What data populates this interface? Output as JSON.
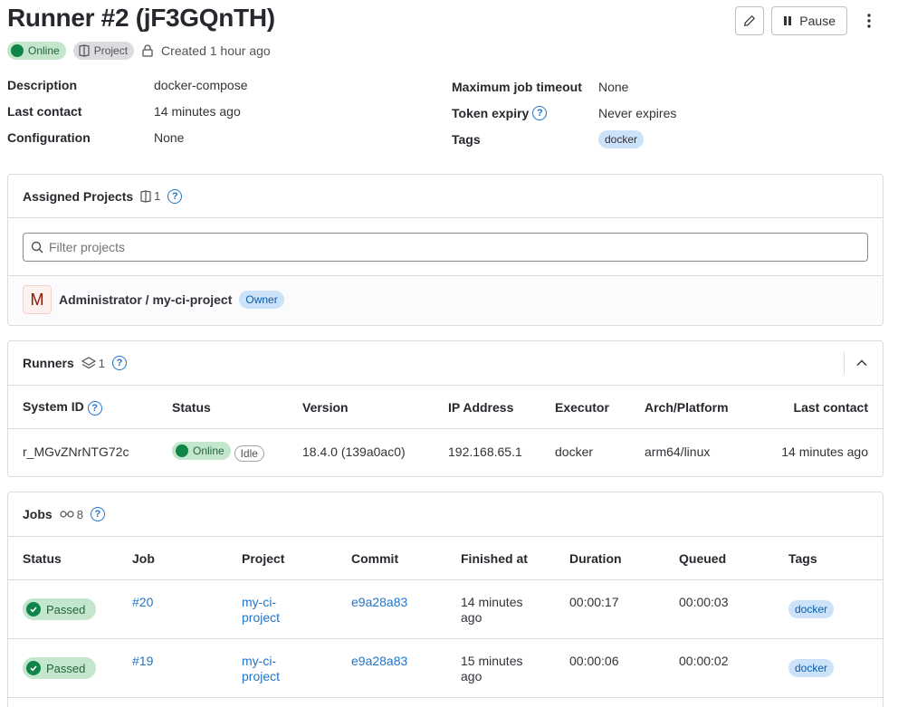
{
  "header": {
    "title": "Runner #2 (jF3GQnTH)",
    "status_badge": "Online",
    "type_badge": "Project",
    "created": "Created 1 hour ago",
    "pause_label": "Pause"
  },
  "details": {
    "description_label": "Description",
    "description_value": "docker-compose",
    "last_contact_label": "Last contact",
    "last_contact_value": "14 minutes ago",
    "configuration_label": "Configuration",
    "configuration_value": "None",
    "max_timeout_label": "Maximum job timeout",
    "max_timeout_value": "None",
    "token_expiry_label": "Token expiry",
    "token_expiry_value": "Never expires",
    "tags_label": "Tags",
    "tag": "docker"
  },
  "assigned_projects": {
    "title": "Assigned Projects",
    "count": "1",
    "filter_placeholder": "Filter projects",
    "avatar_letter": "M",
    "project_name": "Administrator / my-ci-project",
    "role_badge": "Owner"
  },
  "runners": {
    "title": "Runners",
    "count": "1",
    "columns": [
      "System ID",
      "Status",
      "Version",
      "IP Address",
      "Executor",
      "Arch/Platform",
      "Last contact"
    ],
    "row": {
      "system_id": "r_MGvZNrNTG72c",
      "status": "Online",
      "state": "Idle",
      "version": "18.4.0 (139a0ac0)",
      "ip": "192.168.65.1",
      "executor": "docker",
      "arch": "arm64/linux",
      "last_contact": "14 minutes ago"
    }
  },
  "jobs": {
    "title": "Jobs",
    "count": "8",
    "columns": [
      "Status",
      "Job",
      "Project",
      "Commit",
      "Finished at",
      "Duration",
      "Queued",
      "Tags"
    ],
    "rows": [
      {
        "status": "Passed",
        "job": "#20",
        "project_l1": "my-ci-",
        "project_l2": "project",
        "commit": "e9a28a83",
        "finished_l1": "14 minutes",
        "finished_l2": "ago",
        "duration": "00:00:17",
        "queued": "00:00:03",
        "tag": "docker"
      },
      {
        "status": "Passed",
        "job": "#19",
        "project_l1": "my-ci-",
        "project_l2": "project",
        "commit": "e9a28a83",
        "finished_l1": "15 minutes",
        "finished_l2": "ago",
        "duration": "00:00:06",
        "queued": "00:00:02",
        "tag": "docker"
      }
    ]
  },
  "colors": {
    "success": "#108548",
    "link": "#1f75cb",
    "tag_bg": "#cbe2f9"
  }
}
